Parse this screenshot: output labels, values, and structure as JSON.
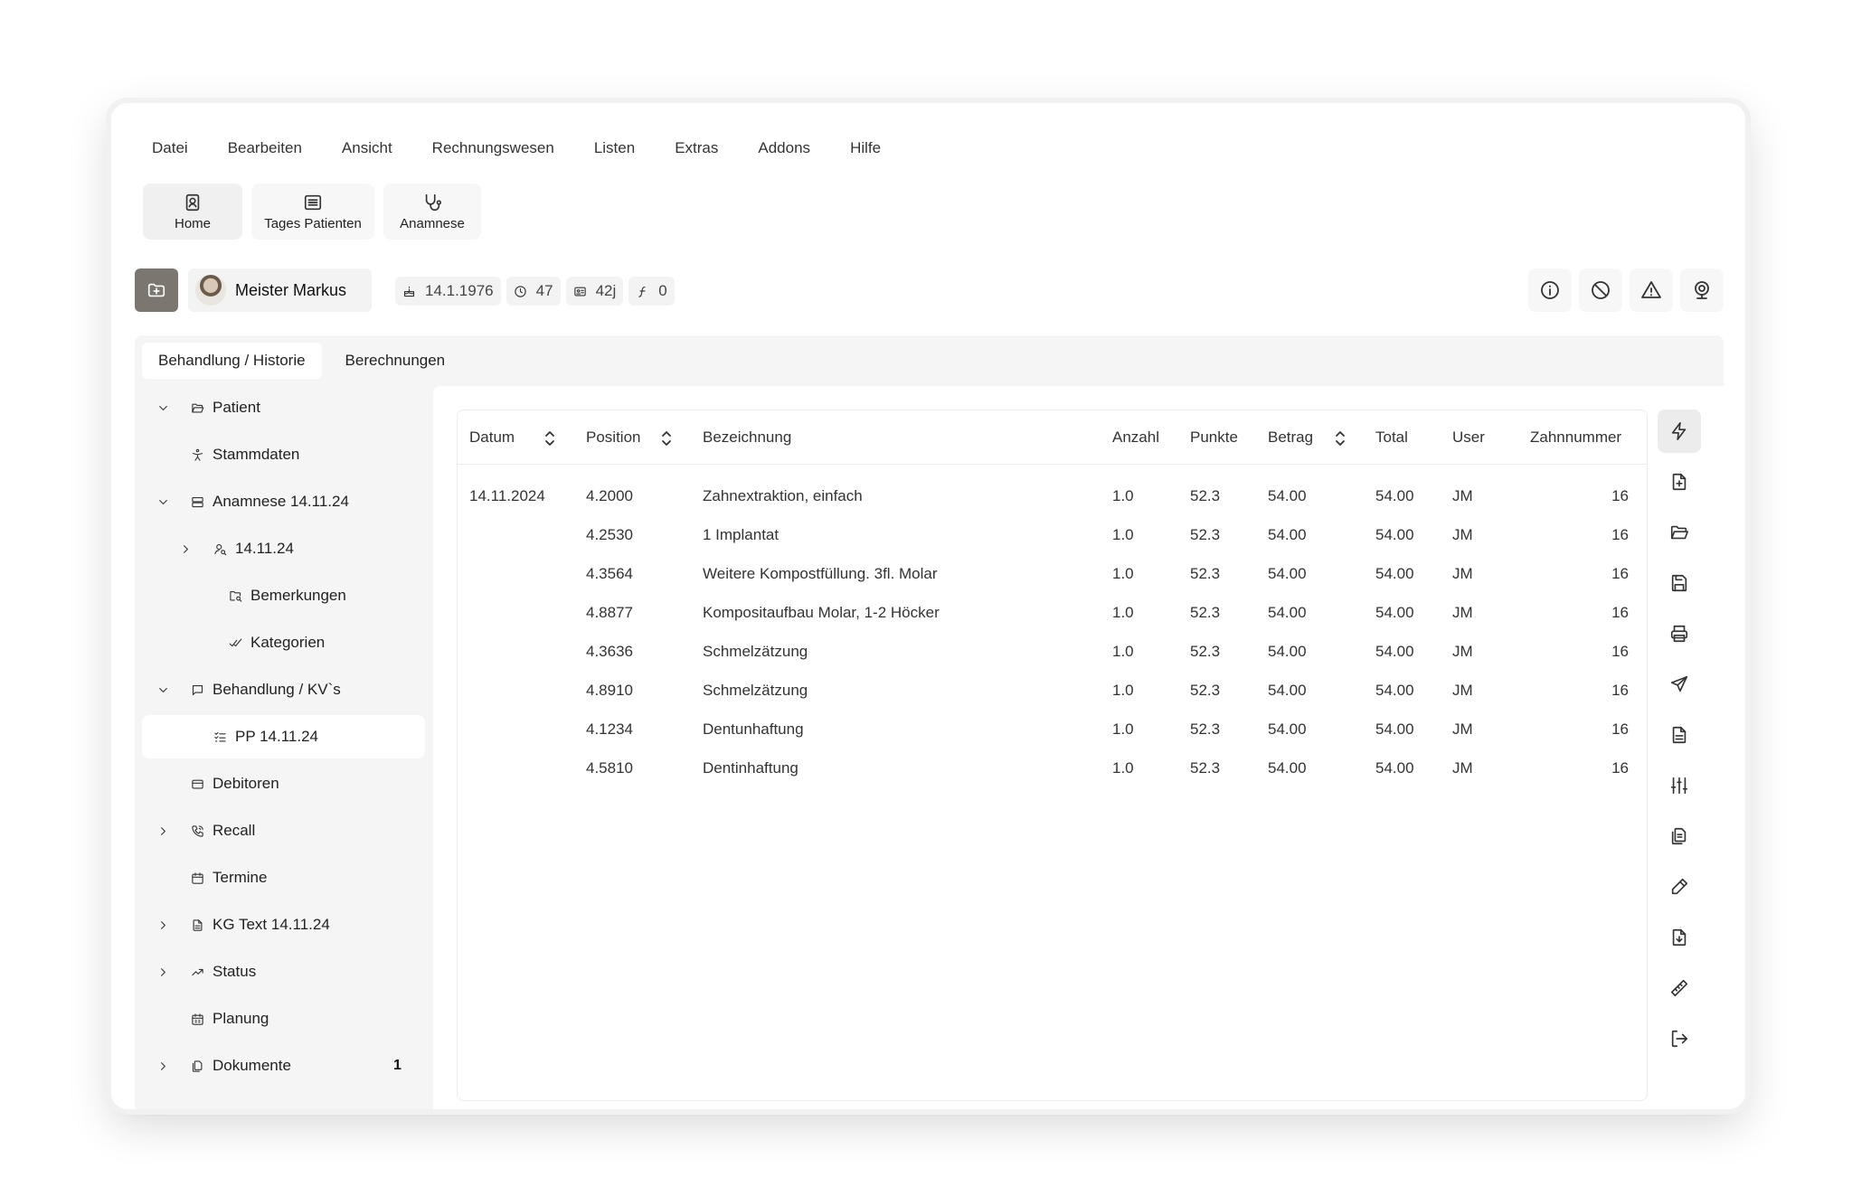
{
  "menu": [
    "Datei",
    "Bearbeiten",
    "Ansicht",
    "Rechnungswesen",
    "Listen",
    "Extras",
    "Addons",
    "Hilfe"
  ],
  "toolbar": [
    {
      "label": "Home",
      "icon": "contact-card-icon"
    },
    {
      "label": "Tages Patienten",
      "icon": "list-icon"
    },
    {
      "label": "Anamnese",
      "icon": "stethoscope-icon"
    }
  ],
  "patient": {
    "name": "Meister Markus",
    "birthdate": "14.1.1976",
    "visits": "47",
    "age": "42j",
    "balance": "0"
  },
  "tabs": [
    "Behandlung / Historie",
    "Berechnungen"
  ],
  "tree": [
    {
      "label": "Patient",
      "chevron": "down",
      "icon": "folder-open-icon",
      "level": 0
    },
    {
      "label": "Stammdaten",
      "chevron": "",
      "icon": "person-icon",
      "level": 0
    },
    {
      "label": "Anamnese 14.11.24",
      "chevron": "down",
      "icon": "server-icon",
      "level": 0
    },
    {
      "label": "14.11.24",
      "chevron": "right",
      "icon": "user-search-icon",
      "level": 1
    },
    {
      "label": "Bemerkungen",
      "chevron": "",
      "icon": "folder-search-icon",
      "level": 2
    },
    {
      "label": "Kategorien",
      "chevron": "",
      "icon": "check-check-icon",
      "level": 2
    },
    {
      "label": "Behandlung / KV`s",
      "chevron": "down",
      "icon": "message-square-icon",
      "level": 0
    },
    {
      "label": "PP 14.11.24",
      "chevron": "",
      "icon": "list-todo-icon",
      "level": 1,
      "selected": true
    },
    {
      "label": "Debitoren",
      "chevron": "",
      "icon": "credit-card-icon",
      "level": 0
    },
    {
      "label": "Recall",
      "chevron": "right",
      "icon": "phone-call-icon",
      "level": 0
    },
    {
      "label": "Termine",
      "chevron": "",
      "icon": "calendar-icon",
      "level": 0
    },
    {
      "label": "KG Text 14.11.24",
      "chevron": "right",
      "icon": "file-text-icon",
      "level": 0
    },
    {
      "label": "Status",
      "chevron": "right",
      "icon": "trending-up-icon",
      "level": 0
    },
    {
      "label": "Planung",
      "chevron": "",
      "icon": "calendar-days-icon",
      "level": 0
    },
    {
      "label": "Dokumente",
      "chevron": "right",
      "icon": "files-icon",
      "level": 0,
      "count": "1"
    }
  ],
  "table": {
    "columns": [
      "Datum",
      "Position",
      "Bezeichnung",
      "Anzahl",
      "Punkte",
      "Betrag",
      "Total",
      "User",
      "Zahnnummer"
    ],
    "rows": [
      [
        "14.11.2024",
        "4.2000",
        "Zahnextraktion, einfach",
        "1.0",
        "52.3",
        "54.00",
        "54.00",
        "JM",
        "16"
      ],
      [
        "",
        "4.2530",
        "1 Implantat",
        "1.0",
        "52.3",
        "54.00",
        "54.00",
        "JM",
        "16"
      ],
      [
        "",
        "4.3564",
        "Weitere Kompostfüllung. 3fl. Molar",
        "1.0",
        "52.3",
        "54.00",
        "54.00",
        "JM",
        "16"
      ],
      [
        "",
        "4.8877",
        "Kompositaufbau Molar, 1-2 Höcker",
        "1.0",
        "52.3",
        "54.00",
        "54.00",
        "JM",
        "16"
      ],
      [
        "",
        "4.3636",
        "Schmelzätzung",
        "1.0",
        "52.3",
        "54.00",
        "54.00",
        "JM",
        "16"
      ],
      [
        "",
        "4.8910",
        "Schmelzätzung",
        "1.0",
        "52.3",
        "54.00",
        "54.00",
        "JM",
        "16"
      ],
      [
        "",
        "4.1234",
        "Dentunhaftung",
        "1.0",
        "52.3",
        "54.00",
        "54.00",
        "JM",
        "16"
      ],
      [
        "",
        "4.5810",
        "Dentinhaftung",
        "1.0",
        "52.3",
        "54.00",
        "54.00",
        "JM",
        "16"
      ]
    ]
  },
  "side_actions": [
    "zap-icon",
    "file-plus-icon",
    "folder-open-icon",
    "save-icon",
    "printer-icon",
    "send-icon",
    "file-text-icon",
    "sliders-icon",
    "files-icon",
    "pencil-icon",
    "file-down-icon",
    "ruler-icon",
    "logout-icon"
  ],
  "header_actions": [
    "info-icon",
    "ban-icon",
    "alert-triangle-icon",
    "webcam-icon"
  ]
}
